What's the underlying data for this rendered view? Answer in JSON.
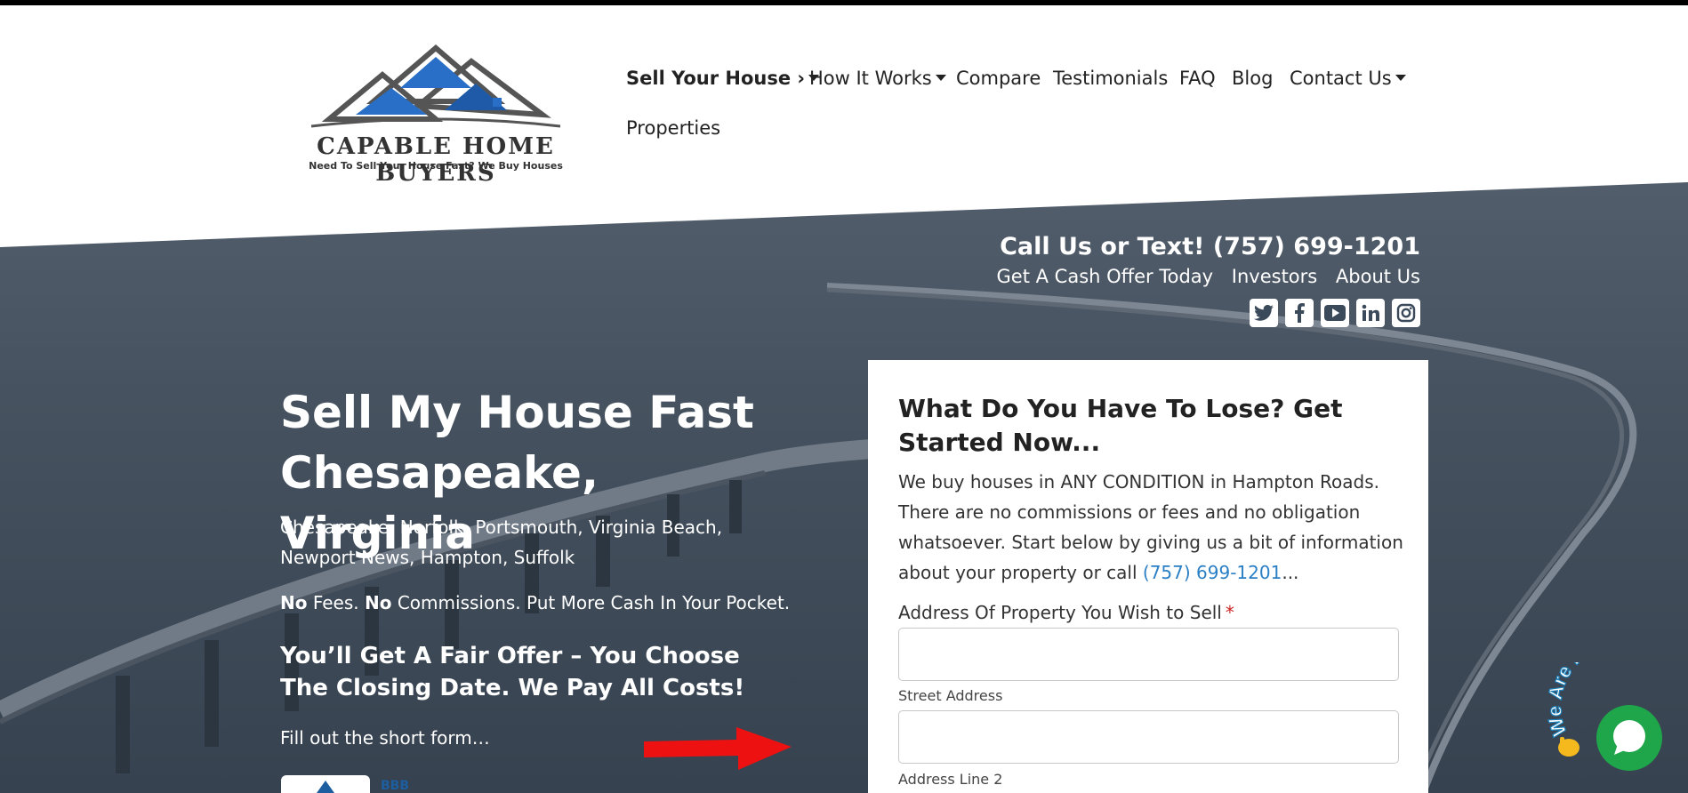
{
  "brand": {
    "name": "CAPABLE HOME BUYERS",
    "tagline": "Need To Sell Your House Fast? We Buy Houses"
  },
  "nav": {
    "items": [
      {
        "label": "Sell Your House ›"
      },
      {
        "label": "How It Works"
      },
      {
        "label": "Compare"
      },
      {
        "label": "Testimonials"
      },
      {
        "label": "FAQ"
      },
      {
        "label": "Blog"
      },
      {
        "label": "Contact Us"
      },
      {
        "label": "Properties"
      }
    ]
  },
  "contact": {
    "call": "Call Us or Text! (757) 699-1201",
    "links": [
      "Get A Cash Offer Today",
      "Investors",
      "About Us"
    ],
    "socials": [
      "twitter-icon",
      "facebook-icon",
      "youtube-icon",
      "linkedin-icon",
      "instagram-icon"
    ]
  },
  "hero": {
    "title": "Sell My House Fast Chesapeake, Virginia",
    "areas": "Chesapeake, Norfolk, Portsmouth, Virginia Beach, Newport News, Hampton, Suffolk",
    "no1": "No",
    "fees_text": " Fees. ",
    "no2": "No",
    "comm_text": " Commissions. Put More Cash In Your Pocket.",
    "fair": "You’ll Get A Fair Offer – You Choose The Closing Date. We Pay All Costs!",
    "fill": "Fill out the short form…",
    "badge_text": "BBB"
  },
  "form": {
    "heading": "What Do You Have To Lose? Get Started Now...",
    "intro": "We buy houses in ANY CONDITION in Hampton Roads. There are no commissions or fees and no obligation whatsoever. Start below by giving us a bit of information about your property or call ",
    "phone": "(757) 699-1201",
    "intro_end": "...",
    "address_label": "Address Of Property You Wish to Sell",
    "required_mark": "*",
    "street_label": "Street Address",
    "line2_label": "Address Line 2"
  },
  "chat": {
    "badge": "We Are Here!"
  },
  "colors": {
    "hero_overlay": "#3d4a58",
    "link": "#2a7fc5",
    "chat": "#1fa64a",
    "arrow": "#ee1111"
  }
}
